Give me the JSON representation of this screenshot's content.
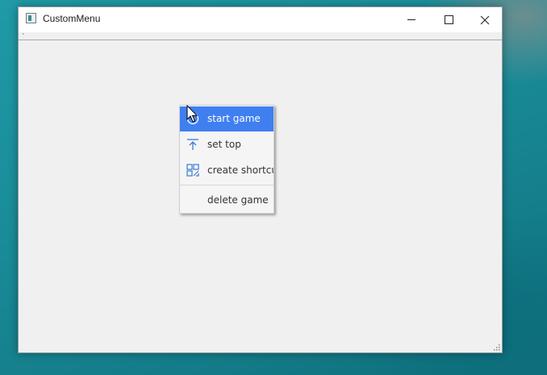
{
  "window": {
    "title": "CustomMenu",
    "app_icon": "window-app-icon",
    "controls": {
      "minimize": "minimize-icon",
      "maximize": "maximize-icon",
      "close": "close-icon"
    }
  },
  "context_menu": {
    "items": [
      {
        "label": "start game",
        "icon": "play-circle-icon",
        "highlighted": true
      },
      {
        "label": "set top",
        "icon": "arrow-to-top-icon",
        "highlighted": false
      },
      {
        "label": "create shortcut",
        "icon": "qr-code-icon",
        "highlighted": false
      },
      {
        "label": "delete game",
        "icon": "",
        "highlighted": false
      }
    ]
  },
  "colors": {
    "highlight": "#3f7ff0",
    "desktop": "#1a8c99",
    "window_bg": "#f0f0f0"
  }
}
